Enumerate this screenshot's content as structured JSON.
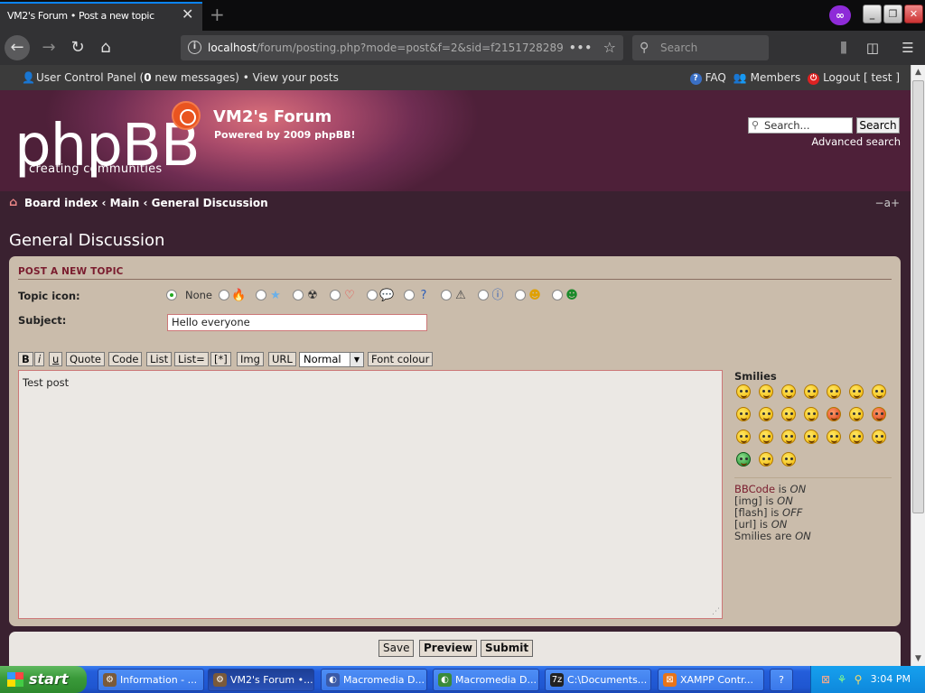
{
  "browser": {
    "tab_title": "VM2's Forum • Post a new topic",
    "url_host": "localhost",
    "url_rest": "/forum/posting.php?mode=post&f=2&sid=f2151728289",
    "search_placeholder": "Search"
  },
  "top_strip": {
    "ucp_label": "User Control Panel (",
    "ucp_count": "0",
    "ucp_suffix": " new messages) • View your posts",
    "faq": "FAQ",
    "members": "Members",
    "logout": "Logout [ test ]"
  },
  "header": {
    "logo_main": "phpBB",
    "logo_sub": "creating   communities",
    "site_title": "VM2's Forum",
    "site_description": "Powered by 2009 phpBB!",
    "search_placeholder": "Search...",
    "search_button": "Search",
    "advanced_search": "Advanced search"
  },
  "breadcrumb": [
    "Board index",
    "Main",
    "General Discussion"
  ],
  "breadcrumb_separator": " ‹ ",
  "page_title": "General Discussion",
  "form": {
    "heading": "POST A NEW TOPIC",
    "topic_icon_label": "Topic icon:",
    "none_label": "None",
    "topic_icons": [
      "fire-icon",
      "star-icon",
      "radioactive-icon",
      "heart-icon",
      "speech-bubble-icon",
      "question-icon",
      "warning-icon",
      "info-icon",
      "arrow-smiley-icon",
      "mrgreen-icon"
    ],
    "subject_label": "Subject:",
    "subject_value": "Hello everyone",
    "bbcode_buttons": [
      "B",
      "i",
      "u",
      "Quote",
      "Code",
      "List",
      "List=",
      "[*]",
      "Img",
      "URL"
    ],
    "font_size_selected": "Normal",
    "font_colour_button": "Font colour",
    "message": "Test post",
    "smilies_title": "Smilies",
    "status": {
      "bbcode_link": "BBCode",
      "bbcode_text": " is ",
      "bbcode_state": "ON",
      "img_text": "[img] is ",
      "img_state": "ON",
      "flash_text": "[flash] is ",
      "flash_state": "OFF",
      "url_text": "[url] is ",
      "url_state": "ON",
      "smilies_text": "Smilies are ",
      "smilies_state": "ON"
    },
    "buttons": {
      "save": "Save",
      "preview": "Preview",
      "submit": "Submit"
    }
  },
  "taskbar": {
    "start": "start",
    "tasks": [
      "Information - ...",
      "VM2's Forum •...",
      "Macromedia D...",
      "Macromedia D...",
      "C:\\Documents...",
      "XAMPP Contr..."
    ],
    "clock": "3:04 PM"
  },
  "colors": {
    "accent": "#7a1c2e",
    "header_bg": "#6f2d52",
    "panel_bg": "#cabcab"
  }
}
